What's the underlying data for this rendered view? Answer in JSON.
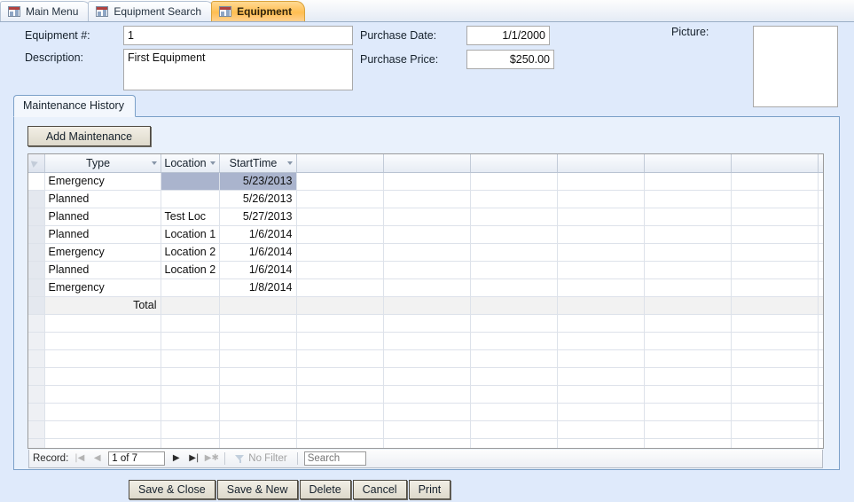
{
  "tabs": [
    {
      "label": "Main Menu",
      "icon": "form-icon",
      "active": false
    },
    {
      "label": "Equipment Search",
      "icon": "form-icon",
      "active": false
    },
    {
      "label": "Equipment",
      "icon": "form-icon",
      "active": true
    }
  ],
  "header": {
    "equipment_number_label": "Equipment #:",
    "equipment_number_value": "1",
    "description_label": "Description:",
    "description_value": "First Equipment",
    "purchase_date_label": "Purchase Date:",
    "purchase_date_value": "1/1/2000",
    "purchase_price_label": "Purchase Price:",
    "purchase_price_value": "$250.00",
    "picture_label": "Picture:"
  },
  "subform": {
    "tab_label": "Maintenance History",
    "add_button_label": "Add Maintenance"
  },
  "datasheet": {
    "columns": [
      "Type",
      "Location",
      "StartTime"
    ],
    "rows": [
      {
        "type": "Emergency",
        "location": "",
        "starttime": "5/23/2013"
      },
      {
        "type": "Planned",
        "location": "",
        "starttime": "5/26/2013"
      },
      {
        "type": "Planned",
        "location": "Test Loc",
        "starttime": "5/27/2013"
      },
      {
        "type": "Planned",
        "location": "Location 1",
        "starttime": "1/6/2014"
      },
      {
        "type": "Emergency",
        "location": "Location 2",
        "starttime": "1/6/2014"
      },
      {
        "type": "Planned",
        "location": "Location 2",
        "starttime": "1/6/2014"
      },
      {
        "type": "Emergency",
        "location": "",
        "starttime": "1/8/2014"
      }
    ],
    "total_label": "Total"
  },
  "navigation": {
    "record_label": "Record:",
    "first_icon": "first-record-icon",
    "previous_icon": "previous-record-icon",
    "counter_value": "1 of 7",
    "next_icon": "next-record-icon",
    "last_icon": "last-record-icon",
    "new_icon": "new-record-icon",
    "filter_label": "No Filter",
    "filter_icon": "funnel-icon",
    "search_placeholder": "Search"
  },
  "footer": {
    "buttons": [
      {
        "label": "Save & Close"
      },
      {
        "label": "Save & New"
      },
      {
        "label": "Delete"
      },
      {
        "label": "Cancel"
      },
      {
        "label": "Print"
      }
    ]
  },
  "colors": {
    "form_background": "#dfeafb",
    "active_tab": "#ffbe52",
    "selection": "#aab4cd",
    "panel_border": "#7ba0c8"
  }
}
